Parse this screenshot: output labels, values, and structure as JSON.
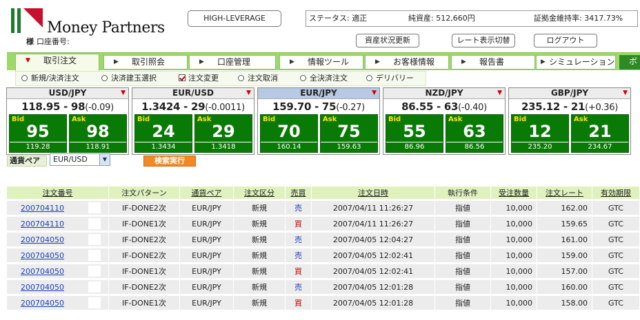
{
  "brand": {
    "name": "Money Partners",
    "colors": {
      "red": "#c8102e",
      "green": "#1e7a2e"
    }
  },
  "account": {
    "prefix": "様",
    "label": "口座番号:"
  },
  "header": {
    "leverage_button": "HIGH-LEVERAGE",
    "status": "ステータス: 適正",
    "net_assets": "純資産: 512,660円",
    "margin_ratio": "証拠金維持率: 3417.73%",
    "refresh_button": "資産状況更新",
    "rate_display_button": "レート表示切替",
    "logout_button": "ログアウト"
  },
  "menu": {
    "tabs": [
      {
        "label": "取引注文",
        "active": true
      },
      {
        "label": "取引照会",
        "active": false
      },
      {
        "label": "口座管理",
        "active": false
      },
      {
        "label": "情報ツール",
        "active": false
      },
      {
        "label": "お客様情報",
        "active": false
      },
      {
        "label": "報告書",
        "active": false
      },
      {
        "label": "シミュレーション",
        "active": false
      },
      {
        "label": "ボ",
        "active": false
      }
    ],
    "submenu": [
      {
        "label": "新規/決済注文",
        "type": "radio"
      },
      {
        "label": "決済建玉選択",
        "type": "radio"
      },
      {
        "label": "注文変更",
        "type": "check"
      },
      {
        "label": "注文取消",
        "type": "radio"
      },
      {
        "label": "全決済注文",
        "type": "radio"
      },
      {
        "label": "デリバリー",
        "type": "radio"
      }
    ]
  },
  "rates": [
    {
      "pair": "USD/JPY",
      "rate": "118.95 - 98",
      "change": "(-0.09)",
      "bid_label": "Bid",
      "ask_label": "Ask",
      "bid": "95",
      "ask": "98",
      "bid_high": "119.28",
      "ask_low": "118.91",
      "selected": false
    },
    {
      "pair": "EUR/USD",
      "rate": "1.3424 - 29",
      "change": "(-0.0011)",
      "bid_label": "Bid",
      "ask_label": "Ask",
      "bid": "24",
      "ask": "29",
      "bid_high": "1.3434",
      "ask_low": "1.3418",
      "selected": false
    },
    {
      "pair": "EUR/JPY",
      "rate": "159.70 - 75",
      "change": "(-0.27)",
      "bid_label": "Bid",
      "ask_label": "Ask",
      "bid": "70",
      "ask": "75",
      "bid_high": "160.14",
      "ask_low": "159.63",
      "selected": true
    },
    {
      "pair": "NZD/JPY",
      "rate": "86.55 - 63",
      "change": "(-0.40)",
      "bid_label": "Bid",
      "ask_label": "Ask",
      "bid": "55",
      "ask": "63",
      "bid_high": "86.96",
      "ask_low": "86.56",
      "selected": false
    },
    {
      "pair": "GBP/JPY",
      "rate": "235.12 - 21",
      "change": "(+0.36)",
      "bid_label": "Bid",
      "ask_label": "Ask",
      "bid": "12",
      "ask": "21",
      "bid_high": "235.20",
      "ask_low": "234.67",
      "selected": false
    }
  ],
  "filter": {
    "pair_label": "通貨ペア",
    "pair_value": "EUR/USD",
    "search_button": "検索実行"
  },
  "orders": {
    "columns": [
      "注文番号",
      "注文パターン",
      "通貨ペア",
      "注文区分",
      "売買",
      "注文日時",
      "執行条件",
      "受注数量",
      "注文レート",
      "有効期限"
    ],
    "rows": [
      {
        "id": "200704110",
        "pattern": "IF-DONE2次",
        "pair": "EUR/JPY",
        "kind": "新規",
        "side": "売",
        "datetime": "2007/04/11 11:26:27",
        "condition": "指値",
        "qty": "10,000",
        "rate": "162.00",
        "expiry": "GTC"
      },
      {
        "id": "200704110",
        "pattern": "IF-DONE1次",
        "pair": "EUR/JPY",
        "kind": "新規",
        "side": "買",
        "datetime": "2007/04/11 11:26:27",
        "condition": "指値",
        "qty": "10,000",
        "rate": "159.65",
        "expiry": "GTC"
      },
      {
        "id": "200704050",
        "pattern": "IF-DONE2次",
        "pair": "EUR/JPY",
        "kind": "新規",
        "side": "売",
        "datetime": "2007/04/05 12:04:27",
        "condition": "指値",
        "qty": "10,000",
        "rate": "161.00",
        "expiry": "GTC"
      },
      {
        "id": "200704050",
        "pattern": "IF-DONE2次",
        "pair": "EUR/JPY",
        "kind": "新規",
        "side": "売",
        "datetime": "2007/04/05 12:02:41",
        "condition": "指値",
        "qty": "10,000",
        "rate": "159.00",
        "expiry": "GTC"
      },
      {
        "id": "200704050",
        "pattern": "IF-DONE1次",
        "pair": "EUR/JPY",
        "kind": "新規",
        "side": "買",
        "datetime": "2007/04/05 12:02:41",
        "condition": "指値",
        "qty": "10,000",
        "rate": "157.00",
        "expiry": "GTC"
      },
      {
        "id": "200704050",
        "pattern": "IF-DONE2次",
        "pair": "EUR/JPY",
        "kind": "新規",
        "side": "売",
        "datetime": "2007/04/05 12:01:28",
        "condition": "指値",
        "qty": "10,000",
        "rate": "160.00",
        "expiry": "GTC"
      },
      {
        "id": "200704050",
        "pattern": "IF-DONE1次",
        "pair": "EUR/JPY",
        "kind": "新規",
        "side": "買",
        "datetime": "2007/04/05 12:01:28",
        "condition": "指値",
        "qty": "10,000",
        "rate": "158.00",
        "expiry": "GTC"
      }
    ]
  }
}
